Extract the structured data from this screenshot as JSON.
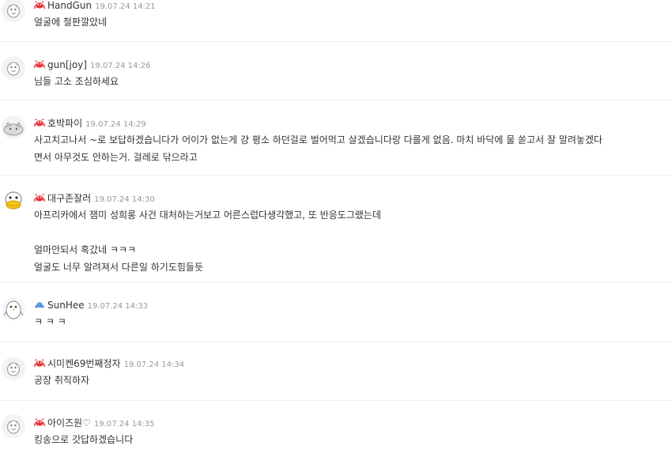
{
  "comments": [
    {
      "nick": "HandGun",
      "date": "19.07.24 14:21",
      "level_icon": "crab-icon",
      "avatar_icon": "default-avatar-icon",
      "lines": [
        "얼굴에 철판깔았네"
      ]
    },
    {
      "nick": "gun[joy]",
      "date": "19.07.24 14:26",
      "level_icon": "crab-icon",
      "avatar_icon": "default-avatar-icon",
      "lines": [
        "님들 고소 조심하세요"
      ]
    },
    {
      "nick": "호박파이",
      "date": "19.07.24 14:29",
      "level_icon": "crab-icon",
      "avatar_icon": "cat-avatar-icon",
      "lines": [
        "사고치고나서 ~로 보답하겠습니다가 어이가 없는게 걍 평소 하던걸로 벌어먹고 살겠습니다랑 다를게 없음. 마치 바닥에 물 쏟고서 잘 말려놓겠다",
        "면서 아무것도 안하는거. 걸레로 닦으라고"
      ]
    },
    {
      "nick": "대구존잘러",
      "date": "19.07.24 14:30",
      "level_icon": "crab-icon",
      "avatar_icon": "duck-avatar-icon",
      "lines": [
        "아프리카에서 잼미 성희롱 사건 대처하는거보고 어른스럽다생각했고, 또 반응도그랬는데",
        "",
        "얼마안되서 혹갔네 ㅋㅋㅋ",
        "얼굴도 너무 알려져서 다른일 하기도힘들듯"
      ]
    },
    {
      "nick": "SunHee",
      "date": "19.07.24 14:33",
      "level_icon": "shell-icon",
      "avatar_icon": "penguin-avatar-icon",
      "lines": [
        "ㅋ ㅋ ㅋ"
      ]
    },
    {
      "nick": "시미켄69번째정자",
      "date": "19.07.24 14:34",
      "level_icon": "crab-icon",
      "avatar_icon": "default-avatar-icon",
      "lines": [
        "공장 취직하자"
      ]
    },
    {
      "nick": "아이즈원♡",
      "date": "19.07.24 14:35",
      "level_icon": "crab-icon",
      "avatar_icon": "default-avatar-icon",
      "lines": [
        "킹송으로 갓답하겠습니다"
      ]
    }
  ],
  "colors": {
    "nick": "#333333",
    "date": "#999999",
    "text": "#333333",
    "crab": "#e8383d",
    "shell": "#3b7bd4",
    "divider": "#f0f0f0"
  }
}
